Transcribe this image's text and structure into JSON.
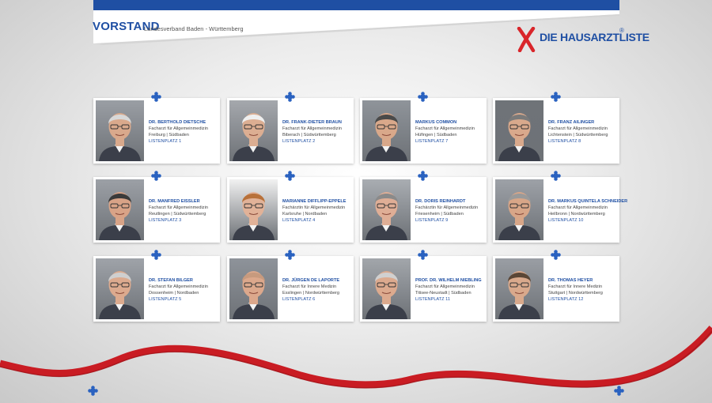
{
  "header": {
    "title": "VORSTAND",
    "subtitle": "Landesverband Baden - Württemberg"
  },
  "logo": {
    "text": "DIE HAUSARZTLISTE",
    "mark": "®",
    "colors": {
      "blue": "#1f4fa3",
      "red": "#d9252a"
    }
  },
  "members": [
    {
      "name": "DR. BERTHOLD DIETSCHE",
      "role": "Facharzt für Allgemeinmedizin",
      "location": "Freiburg | Südbaden",
      "list": "LISTENPLATZ 1",
      "photo": "portrait-photo",
      "hair": "#d8d8d8",
      "skin": "#d9a98c",
      "bg": "#9a9ea4"
    },
    {
      "name": "DR. FRANK-DIETER BRAUN",
      "role": "Facharzt für Allgemeinmedizin",
      "location": "Biberach | Südwürttemberg",
      "list": "LISTENPLATZ 2",
      "photo": "portrait-photo",
      "hair": "#efefef",
      "skin": "#dcae92",
      "bg": "#a5a8ad"
    },
    {
      "name": "MARKUS COMMON",
      "role": "Facharzt für Allgemeinmedizin",
      "location": "Hüfingen | Südbaden",
      "list": "LISTENPLATZ 7",
      "photo": "portrait-photo",
      "hair": "#4a4a4a",
      "skin": "#d9a88a",
      "bg": "#8f949a"
    },
    {
      "name": "DR. FRANZ AILINGER",
      "role": "Facharzt für Allgemeinmedizin",
      "location": "Lichtenstein | Südwürttemberg",
      "list": "LISTENPLATZ 8",
      "photo": "portrait-photo",
      "hair": "#7a7a7a",
      "skin": "#d9a98c",
      "bg": "#6f7378"
    },
    {
      "name": "DR. MANFRED EISSLER",
      "role": "Facharzt für Allgemeinmedizin",
      "location": "Reutlingen | Südwürttemberg",
      "list": "LISTENPLATZ 3",
      "photo": "portrait-photo",
      "hair": "#3a3a3a",
      "skin": "#d8a387",
      "bg": "#9ca0a6"
    },
    {
      "name": "MARIANNE DIFFLIPP-EPPELE",
      "role": "Fachärztin für Allgemeinmedizin",
      "location": "Karlsruhe | Nordbaden",
      "list": "LISTENPLATZ 4",
      "photo": "portrait-photo",
      "hair": "#b8713a",
      "skin": "#e1b298",
      "bg": "#f1f1f1"
    },
    {
      "name": "DR. DORIS REINHARDT",
      "role": "Fachärztin für Allgemeinmedizin",
      "location": "Friesenheim | Südbaden",
      "list": "LISTENPLATZ 9",
      "photo": "portrait-photo",
      "hair": "#8a8a8a",
      "skin": "#dfae96",
      "bg": "#a9adb2"
    },
    {
      "name": "DR. MARKUS QUINTELA SCHNEIDER",
      "role": "Facharzt für Allgemeinmedizin",
      "location": "Heilbronn | Nordwürttemberg",
      "list": "LISTENPLATZ 10",
      "photo": "portrait-photo",
      "hair": "#9a9a9a",
      "skin": "#d8a688",
      "bg": "#9da1a7"
    },
    {
      "name": "DR. STEFAN BILGER",
      "role": "Facharzt für Allgemeinmedizin",
      "location": "Dossenheim | Nordbaden",
      "list": "LISTENPLATZ 5",
      "photo": "portrait-photo",
      "hair": "#cfcfcf",
      "skin": "#dcaa8e",
      "bg": "#9fa3a9"
    },
    {
      "name": "DR. JÜRGEN DE LAPORTE",
      "role": "Facharzt für Innere Medizin",
      "location": "Esslingen | Nordwürttemberg",
      "list": "LISTENPLATZ 6",
      "photo": "portrait-photo",
      "hair": "#c79a7e",
      "skin": "#dca88c",
      "bg": "#8e939a"
    },
    {
      "name": "PROF. DR. WILHELM NIEBLING",
      "role": "Facharzt für Allgemeinmedizin",
      "location": "Titisee-Neustadt | Südbaden",
      "list": "LISTENPLATZ 11",
      "photo": "portrait-photo",
      "hair": "#d0d0d0",
      "skin": "#dcaa8e",
      "bg": "#a2a6ab"
    },
    {
      "name": "DR. THOMAS HEYER",
      "role": "Facharzt für Innere Medizin",
      "location": "Stuttgart | Nordwürttemberg",
      "list": "LISTENPLATZ 12",
      "photo": "portrait-photo",
      "hair": "#5a4636",
      "skin": "#d9a98c",
      "bg": "#9a9ea4"
    }
  ]
}
